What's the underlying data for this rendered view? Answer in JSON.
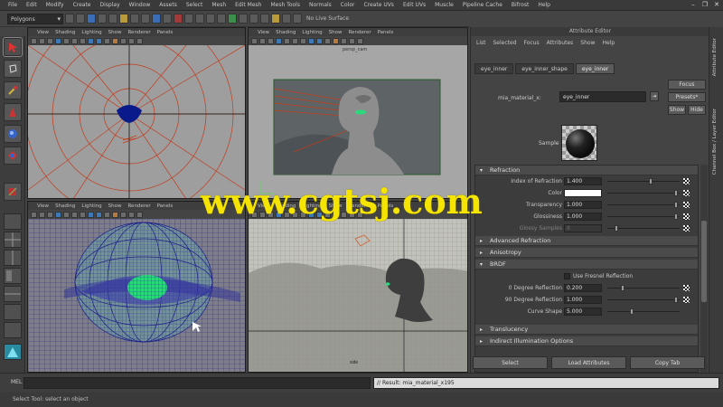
{
  "menubar": {
    "items": [
      "File",
      "Edit",
      "Modify",
      "Create",
      "Display",
      "Window",
      "Assets",
      "Select",
      "Mesh",
      "Edit Mesh",
      "Mesh Tools",
      "Normals",
      "Color",
      "Create UVs",
      "Edit UVs",
      "Muscle",
      "Pipeline Cache",
      "Bifrost",
      "Help"
    ]
  },
  "statusline": {
    "mode": "Polygons",
    "live_surface": "No Live Surface"
  },
  "viewports": [
    {
      "menu": [
        "View",
        "Shading",
        "Lighting",
        "Show",
        "Renderer",
        "Panels"
      ],
      "label": ""
    },
    {
      "menu": [
        "View",
        "Shading",
        "Lighting",
        "Show",
        "Renderer",
        "Panels"
      ],
      "label": "persp_cam"
    },
    {
      "menu": [
        "View",
        "Shading",
        "Lighting",
        "Show",
        "Renderer",
        "Panels"
      ],
      "label": ""
    },
    {
      "menu": [
        "View",
        "Shading",
        "Lighting",
        "Show",
        "Renderer",
        "Panels"
      ],
      "label": "side"
    }
  ],
  "attribute_editor": {
    "title": "Attribute Editor",
    "menu": [
      "List",
      "Selected",
      "Focus",
      "Attributes",
      "Show",
      "Help"
    ],
    "tabs": [
      "eye_inner",
      "eye_inner_shape",
      "eye_inner"
    ],
    "active_tab": 2,
    "material_label": "mia_material_x:",
    "material_value": "eye_inner",
    "buttons": {
      "focus": "Focus",
      "presets": "Presets*",
      "show": "Show",
      "hide": "Hide"
    },
    "sample_label": "Sample",
    "sections": {
      "refraction": "Refraction",
      "advanced_refraction": "Advanced Refraction",
      "anisotropy": "Anisotropy",
      "brdf": "BRDF",
      "translucency": "Translucency",
      "indirect": "Indirect Illumination Options"
    },
    "refraction": [
      {
        "label": "Index of Refraction",
        "value": "1.400",
        "knob": 0.6
      },
      {
        "label": "Color",
        "value": "",
        "knob": 0.98
      },
      {
        "label": "Transparency",
        "value": "1.000",
        "knob": 0.98
      },
      {
        "label": "Glossiness",
        "value": "1.000",
        "knob": 0.98
      },
      {
        "label": "Glossy Samples",
        "value": "8",
        "knob": 0.1
      }
    ],
    "brdf": {
      "fresnel_label": "Use Fresnel Reflection",
      "rows": [
        {
          "label": "0 Degree Reflection",
          "value": "0.200",
          "knob": 0.2
        },
        {
          "label": "90 Degree Reflection",
          "value": "1.000",
          "knob": 0.98
        },
        {
          "label": "Curve Shape",
          "value": "5.000",
          "knob": 0.33
        }
      ]
    },
    "bottom_buttons": [
      "Select",
      "Load Attributes",
      "Copy Tab"
    ]
  },
  "side_tabs": [
    "Attribute Editor",
    "Channel Box / Layer Editor"
  ],
  "command_line": {
    "mel_label": "MEL",
    "result": "// Result: mia_material_x195"
  },
  "help_line": "Select Tool: select an object",
  "watermark": "www.cgtsj.com",
  "colors": {
    "wireframe_blue": "#3a3aa8",
    "selection_green": "#29d97a",
    "curve_red": "#c23b1a",
    "watermark_yellow": "#f5e400"
  }
}
